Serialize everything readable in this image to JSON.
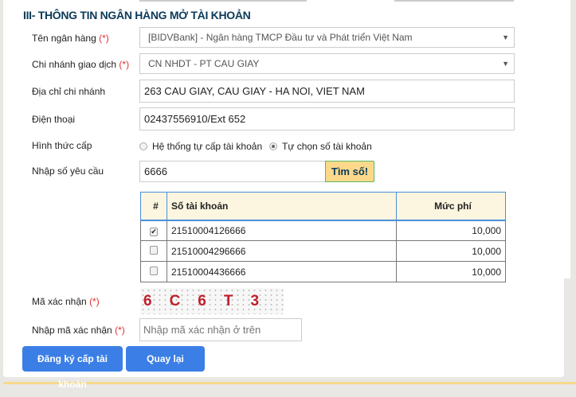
{
  "section_title": "III- THÔNG TIN NGÂN HÀNG MỞ TÀI KHOẢN",
  "required_mark": "(*)",
  "bank": {
    "label": "Tên ngân hàng",
    "value": "[BIDVBank] - Ngân hàng TMCP Đầu tư và Phát triển Việt Nam"
  },
  "branch": {
    "label": "Chi nhánh giao dịch",
    "value": "CN NHDT - PT CAU GIAY"
  },
  "address": {
    "label": "Địa chỉ chi nhánh",
    "value": "263 CAU GIAY, CAU GIAY - HA NOI, VIET NAM"
  },
  "phone": {
    "label": "Điện thoại",
    "value": "02437556910/Ext 652"
  },
  "issue_type": {
    "label": "Hình thức cấp",
    "options": [
      "Hệ thống tự cấp tài khoản",
      "Tự chọn số tài khoản"
    ],
    "selected": 1
  },
  "request": {
    "label": "Nhập số yêu cầu",
    "value": "6666",
    "button": "Tìm số!"
  },
  "table": {
    "headers": [
      "#",
      "Số tài khoản",
      "Mức phí"
    ],
    "rows": [
      {
        "checked": true,
        "account": "21510004126666",
        "fee": "10,000"
      },
      {
        "checked": false,
        "account": "21510004296666",
        "fee": "10,000"
      },
      {
        "checked": false,
        "account": "21510004436666",
        "fee": "10,000"
      }
    ]
  },
  "captcha": {
    "label": "Mã xác nhận",
    "text": "6C6T3"
  },
  "captcha_input": {
    "label": "Nhập mã xác nhận",
    "placeholder": "Nhập mã xác nhận ở trên"
  },
  "buttons": {
    "register": "Đăng ký cấp tài khoản",
    "back": "Quay lại"
  }
}
